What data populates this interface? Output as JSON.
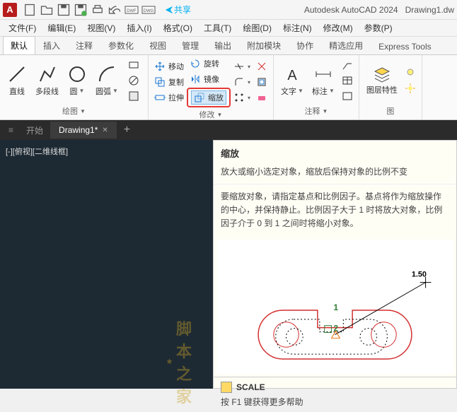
{
  "title": {
    "app": "Autodesk AutoCAD 2024",
    "doc": "Drawing1.dw",
    "share": "共享"
  },
  "menu": [
    "文件(F)",
    "编辑(E)",
    "视图(V)",
    "插入(I)",
    "格式(O)",
    "工具(T)",
    "绘图(D)",
    "标注(N)",
    "修改(M)",
    "参数(P)"
  ],
  "ribbon_tabs": [
    "默认",
    "插入",
    "注释",
    "参数化",
    "视图",
    "管理",
    "输出",
    "附加模块",
    "协作",
    "精选应用",
    "Express Tools"
  ],
  "panels": {
    "draw": {
      "label": "绘图",
      "line": "直线",
      "pline": "多段线",
      "circle": "圆",
      "arc": "圆弧"
    },
    "modify": {
      "label": "修改",
      "move": "移动",
      "copy": "复制",
      "stretch": "拉伸",
      "rotate": "旋转",
      "mirror": "镜像",
      "scale": "缩放"
    },
    "annot": {
      "label": "注释",
      "text": "文字",
      "dim": "标注"
    },
    "layers": {
      "label": "图层特性"
    }
  },
  "doc_tabs": {
    "start": "开始",
    "current": "Drawing1*"
  },
  "canvas": {
    "view_label": "[-][俯视][二维线框]"
  },
  "tooltip": {
    "title": "缩放",
    "desc": "放大或缩小选定对象，缩放后保持对象的比例不变",
    "long": "要缩放对象，请指定基点和比例因子。基点将作为缩放操作的中心，并保持静止。比例因子大于 1 时将放大对象，比例因子介于 0 到 1 之间时将缩小对象。",
    "value_label": "1.50",
    "marker1": "1",
    "marker2": "2",
    "command": "SCALE",
    "f1": "按 F1 键获得更多帮助"
  },
  "watermark": "脚本之家"
}
